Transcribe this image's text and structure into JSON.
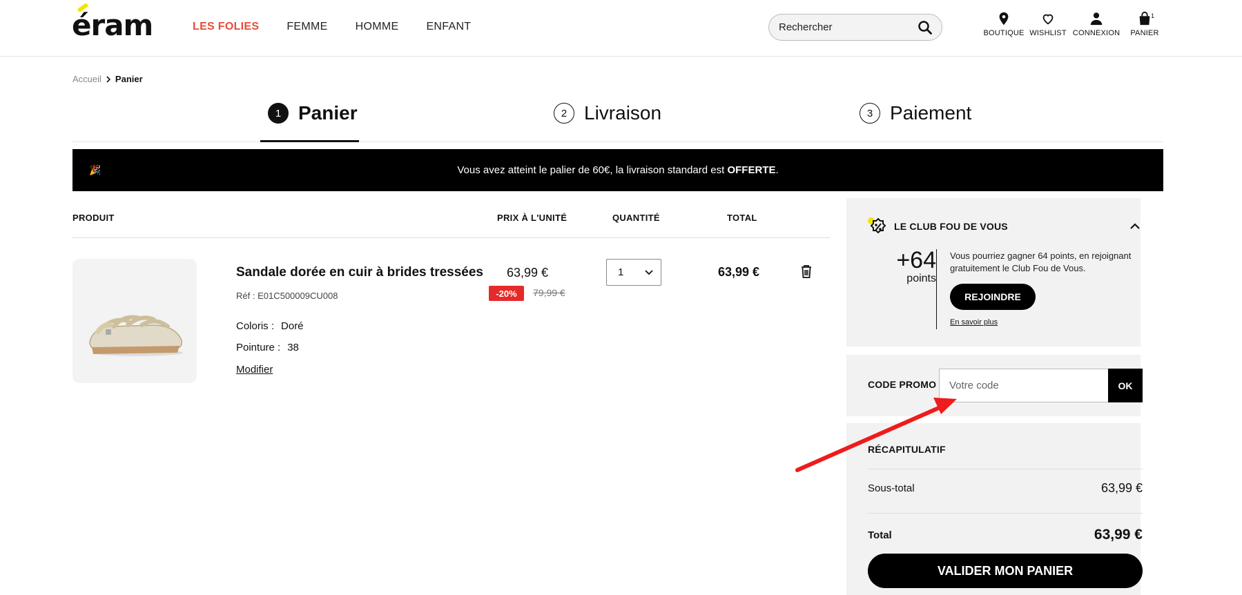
{
  "header": {
    "logo": "éram",
    "nav": [
      "LES FOLIES",
      "FEMME",
      "HOMME",
      "ENFANT"
    ],
    "search_placeholder": "Rechercher",
    "icons": [
      {
        "label": "BOUTIQUE",
        "icon": "location-pin-icon"
      },
      {
        "label": "WISHLIST",
        "icon": "heart-icon"
      },
      {
        "label": "CONNEXION",
        "icon": "user-icon"
      },
      {
        "label": "PANIER",
        "icon": "bag-icon"
      }
    ],
    "cart_count": "1"
  },
  "breadcrumb": {
    "home": "Accueil",
    "current": "Panier"
  },
  "steps": [
    {
      "num": "1",
      "label": "Panier"
    },
    {
      "num": "2",
      "label": "Livraison"
    },
    {
      "num": "3",
      "label": "Paiement"
    }
  ],
  "banner": {
    "text": "Vous avez atteint le palier de 60€, la livraison standard est ",
    "bold": "OFFERTE",
    "end": "."
  },
  "table": {
    "headers": {
      "product": "PRODUIT",
      "unit_price": "PRIX À L'UNITÉ",
      "quantity": "QUANTITÉ",
      "total": "TOTAL"
    }
  },
  "product": {
    "name": "Sandale dorée en cuir à brides tressées",
    "ref": "Réf : E01C500009CU008",
    "color_label": "Coloris :",
    "color_value": "Doré",
    "size_label": "Pointure :",
    "size_value": "38",
    "modify": "Modifier",
    "price": "63,99 €",
    "discount": "-20%",
    "old_price": "79,99 €",
    "quantity": "1",
    "total": "63,99 €"
  },
  "club": {
    "title": "LE CLUB FOU DE VOUS",
    "points": "+64",
    "points_label": "points",
    "description": "Vous pourriez gagner 64 points, en rejoignant gratuitement le Club Fou de Vous.",
    "join": "REJOINDRE",
    "more": "En savoir plus"
  },
  "promo": {
    "label": "CODE PROMO",
    "placeholder": "Votre code",
    "ok": "OK"
  },
  "recap": {
    "title": "RÉCAPITULATIF",
    "subtotal_label": "Sous-total",
    "subtotal_value": "63,99 €",
    "total_label": "Total",
    "total_value": "63,99 €",
    "button": "VALIDER MON PANIER"
  },
  "colors": {
    "accent_red": "#e64b3c",
    "discount_red": "#e52a2a",
    "annotation_arrow": "#ee1c1c"
  }
}
